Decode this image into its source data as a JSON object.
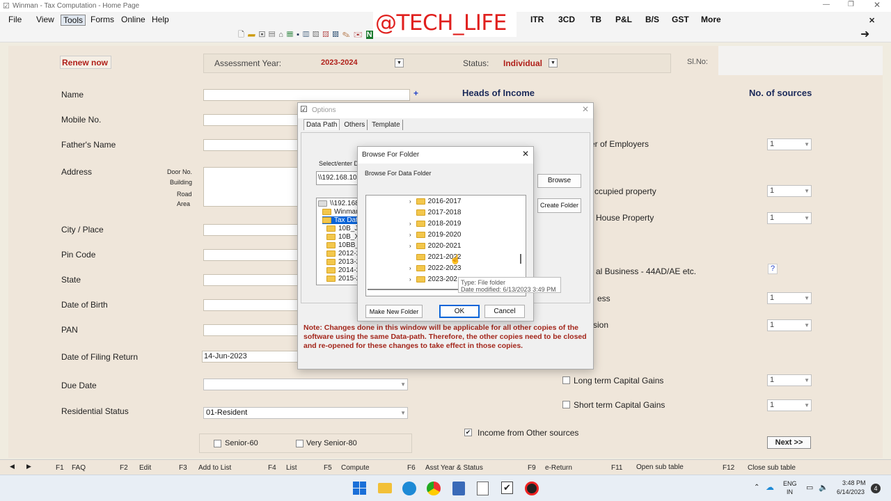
{
  "window": {
    "title": "Winman - Tax Computation - Home Page"
  },
  "watermark": "@TECH_LIFE",
  "menu": {
    "file": "File",
    "view": "View",
    "tools": "Tools",
    "forms": "Forms",
    "online": "Online",
    "help": "Help",
    "itr": "ITR",
    "cd3": "3CD",
    "tb": "TB",
    "pl": "P&L",
    "bs": "B/S",
    "gst": "GST",
    "more": "More"
  },
  "form": {
    "renew": "Renew now",
    "ay_label": "Assessment Year:",
    "ay_value": "2023-2024",
    "status_label": "Status:",
    "status_value": "Individual",
    "slno_label": "Sl.No:",
    "name": "Name",
    "plus": "+",
    "mobile": "Mobile No.",
    "father": "Father's Name",
    "address": "Address",
    "door": "Door No.",
    "building": "Building",
    "road": "Road",
    "area": "Area",
    "city": "City / Place",
    "pin": "Pin Code",
    "state": "State",
    "dob": "Date of Birth",
    "pan": "PAN",
    "dof": "Date of Filing Return",
    "dof_value": "14-Jun-2023",
    "due": "Due Date",
    "res": "Residential Status",
    "res_value": "01-Resident",
    "senior": "Senior-60",
    "vsenior": "Very Senior-80"
  },
  "heads": {
    "title": "Heads of Income",
    "sources_title": "No. of sources",
    "employers": "er of Employers",
    "occupied": "ccupied property",
    "house": "House Property",
    "business": "al Business - 44AD/AE etc.",
    "ess": "ess",
    "sion": "sion",
    "ltcg": "Long term Capital Gains",
    "stcg": "Short term Capital Gains",
    "other": "Income from Other sources",
    "q": "?",
    "one": "1",
    "next": "Next >>"
  },
  "options": {
    "title": "Options",
    "tab1": "Data Path",
    "tab2": "Others",
    "tab3": "Template",
    "select_lbl": "Select/enter D",
    "path": "\\\\192.168.10",
    "browse": "Browse",
    "create": "Create Folder",
    "tree": [
      "\\\\192.168.",
      "Winman_",
      "Tax Dat",
      "10B_JS",
      "10B_XM",
      "10BB_X",
      "2012-2",
      "2013-2",
      "2014-2",
      "2015-2"
    ],
    "note": "Note: Changes done in this window will be applicable for all other copies of the software using the same Data-path. Therefore, the other copies need to be closed and re-opened for these changes to take effect in those copies."
  },
  "browse": {
    "title": "Browse For Folder",
    "subtitle": "Browse For Data Folder",
    "folders": [
      "2016-2017",
      "2017-2018",
      "2018-2019",
      "2019-2020",
      "2020-2021",
      "2021-2022",
      "2022-2023",
      "2023-202"
    ],
    "tip_type": "Type: File folder",
    "tip_date": "Date modified: 6/13/2023 3:49 PM",
    "make": "Make New Folder",
    "ok": "OK",
    "cancel": "Cancel"
  },
  "fkeys": [
    {
      "k": "F1",
      "l": "FAQ"
    },
    {
      "k": "F2",
      "l": "Edit"
    },
    {
      "k": "F3",
      "l": "Add to List"
    },
    {
      "k": "F4",
      "l": "List"
    },
    {
      "k": "F5",
      "l": "Compute"
    },
    {
      "k": "F6",
      "l": "Asst Year & Status"
    },
    {
      "k": "F9",
      "l": "e-Return"
    },
    {
      "k": "F11",
      "l": "Open sub table"
    },
    {
      "k": "F12",
      "l": "Close sub table"
    }
  ],
  "taskbar": {
    "lang1": "ENG",
    "lang2": "IN",
    "time": "3:48 PM",
    "date": "6/14/2023",
    "notif": "4"
  }
}
